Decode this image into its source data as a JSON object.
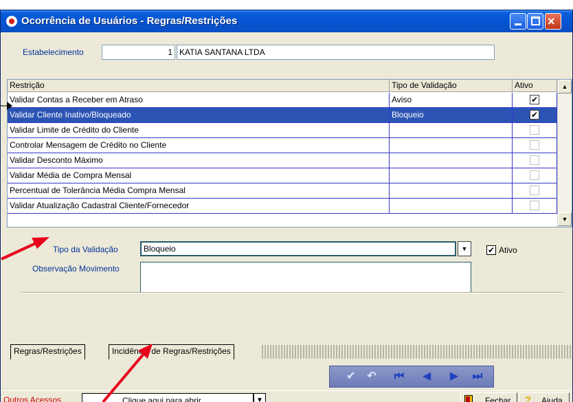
{
  "window": {
    "title": "Ocorrência de Usuários - Regras/Restrições",
    "close_glyph": "×"
  },
  "estabelecimento": {
    "label": "Estabelecimento",
    "code": "1",
    "name": "KATIA SANTANA LTDA"
  },
  "grid": {
    "columns": [
      "Restrição",
      "Tipo de Validação",
      "Ativo"
    ],
    "rows": [
      {
        "restricao": "Validar Contas a Receber em Atraso",
        "tipo": "Aviso",
        "ativo": true
      },
      {
        "restricao": "Validar Cliente Inativo/Bloqueado",
        "tipo": "Bloqueio",
        "ativo": true
      },
      {
        "restricao": "Validar Limite de Crédito do Cliente",
        "tipo": "",
        "ativo": false
      },
      {
        "restricao": "Controlar Mensagem de Crédito no Cliente",
        "tipo": "",
        "ativo": false
      },
      {
        "restricao": "Validar Desconto Máximo",
        "tipo": "",
        "ativo": false
      },
      {
        "restricao": "Validar Média de Compra Mensal",
        "tipo": "",
        "ativo": false
      },
      {
        "restricao": "Percentual de Tolerância Média Compra Mensal",
        "tipo": "",
        "ativo": false
      },
      {
        "restricao": "Validar Atualização Cadastral Cliente/Fornecedor",
        "tipo": "",
        "ativo": false
      }
    ],
    "selected_row": 1,
    "check_glyph": "✔",
    "scroll_up_glyph": "▲",
    "scroll_down_glyph": "▼"
  },
  "form": {
    "tipo_label": "Tipo da Validação",
    "tipo_value": "Bloqueio",
    "ativo_label": "Ativo",
    "ativo_checked": true,
    "observacao_label": "Observação Movimento",
    "dropdown_glyph": "▼"
  },
  "tabs": [
    {
      "label": "Regras/Restrições",
      "active": true
    },
    {
      "label": "Incidência de Regras/Restrições",
      "active": false
    }
  ],
  "navbar": {
    "confirm": "✔",
    "undo": "↶",
    "first": "⏮",
    "prev": "◀",
    "next": "▶",
    "last": "⏭"
  },
  "statusbar": {
    "outros_label": "Outros Acessos",
    "combo_text": "Clique aqui para abrir",
    "combo_glyph": "▼",
    "fechar_label": "Fechar",
    "ajuda_label": "Ajuda",
    "ajuda_glyph": "?"
  },
  "colors": {
    "title_bar": "#0553cf",
    "selected_row": "#2b54b4",
    "label_blue": "#003399",
    "annotation_red": "#e8001c",
    "outros_red": "#cc0000"
  }
}
